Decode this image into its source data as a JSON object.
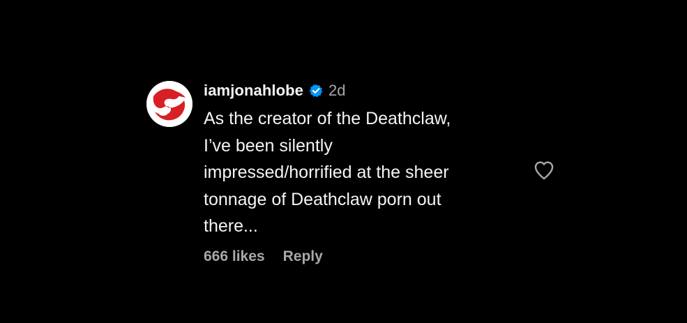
{
  "comment": {
    "avatar_icon": "red-swirl-logo",
    "username": "iamjonahlobe",
    "verified_icon": "verified-badge-icon",
    "age": "2d",
    "text": "As the creator of the Deathclaw,\nI’ve been silently\nimpressed/horrified at the sheer\ntonnage of Deathclaw porn out\nthere...",
    "likes": "666 likes",
    "reply_label": "Reply",
    "like_icon": "heart-outline-icon"
  },
  "colors": {
    "background": "#000000",
    "primary_text": "#f5f5f5",
    "secondary_text": "#a8a8a8",
    "verified_blue": "#0095f6",
    "avatar_red": "#d91f26"
  }
}
